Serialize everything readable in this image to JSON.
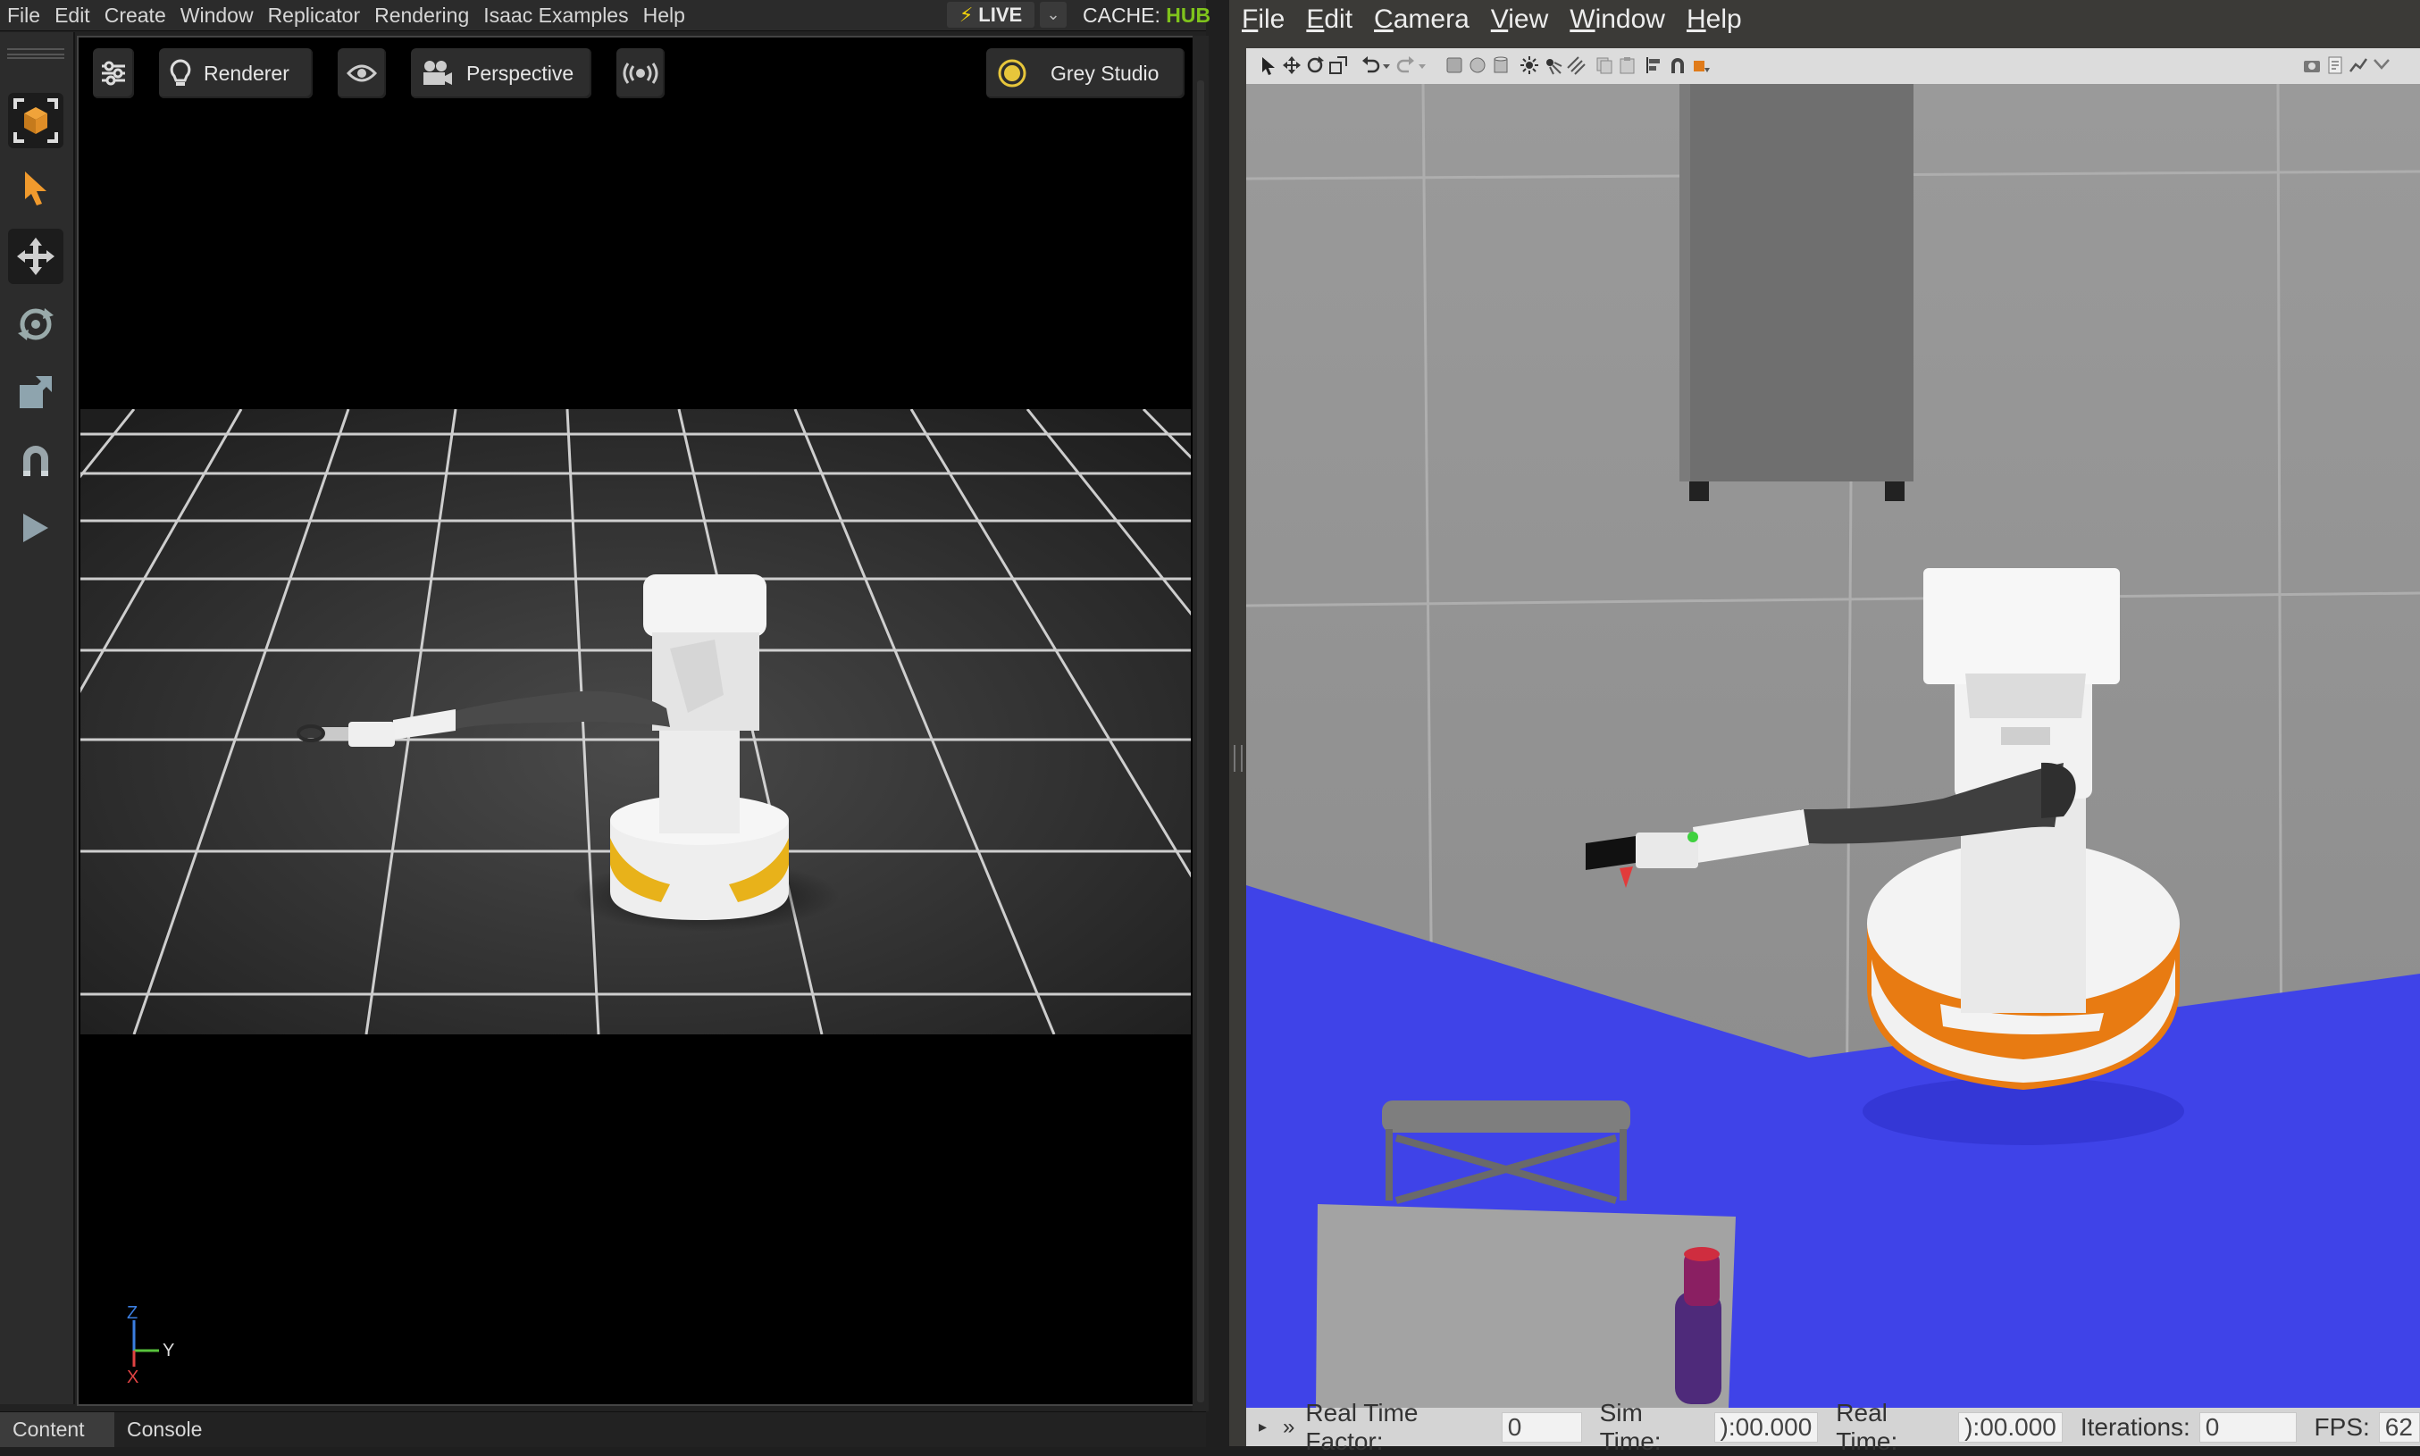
{
  "isaac": {
    "menu": [
      "File",
      "Edit",
      "Create",
      "Window",
      "Replicator",
      "Rendering",
      "Isaac Examples",
      "Help"
    ],
    "live_label": "LIVE",
    "cache_prefix": "CACHE:",
    "cache_value": "HUB",
    "viewport_buttons": {
      "settings_icon": "sliders-icon",
      "renderer": "Renderer",
      "visibility_icon": "eye-icon",
      "perspective": "Perspective",
      "stream_icon": "broadcast-icon",
      "lighting": "Grey Studio"
    },
    "toolbar_icons": [
      "frame-selection-icon",
      "select-arrow-icon",
      "move-icon",
      "rotate-icon",
      "scale-icon",
      "snap-magnet-icon",
      "play-icon"
    ],
    "axis": {
      "z": "Z",
      "y": "Y",
      "x": "X"
    },
    "bottom_tabs": [
      "Content",
      "Console"
    ],
    "colors": {
      "accent_live": "#f2d20b",
      "cache_hub": "#7fc31c",
      "robot_stripe": "#e8b21a"
    }
  },
  "gazebo": {
    "menu": [
      {
        "label": "File",
        "mnemonic": "F"
      },
      {
        "label": "Edit",
        "mnemonic": "E"
      },
      {
        "label": "Camera",
        "mnemonic": "C"
      },
      {
        "label": "View",
        "mnemonic": "V"
      },
      {
        "label": "Window",
        "mnemonic": "W"
      },
      {
        "label": "Help",
        "mnemonic": "H"
      }
    ],
    "status": {
      "real_time_factor_label": "Real Time Factor:",
      "real_time_factor_value": "0",
      "sim_time_label": "Sim Time:",
      "sim_time_value": "):00.000",
      "real_time_label": "Real Time:",
      "real_time_value": "):00.000",
      "iterations_label": "Iterations:",
      "iterations_value": "0",
      "fps_label": "FPS:",
      "fps_value": "62"
    },
    "colors": {
      "laser_scan": "#3f43e8",
      "robot_stripe": "#e87b12",
      "ground": "#8f8f8f"
    }
  }
}
